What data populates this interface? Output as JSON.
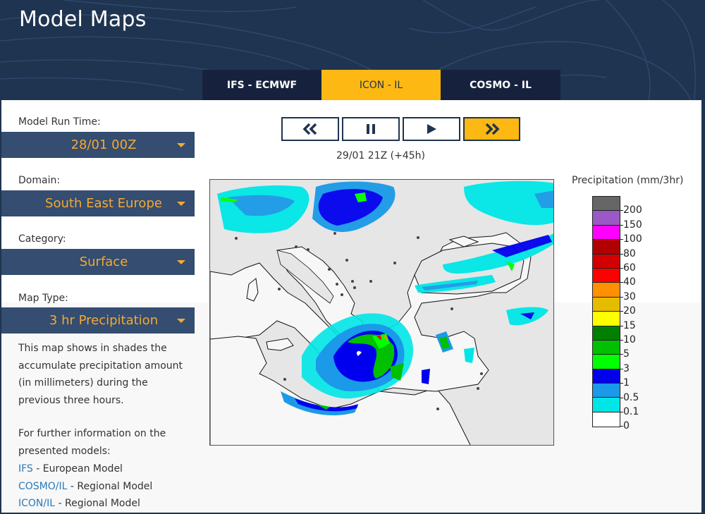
{
  "header": {
    "title": "Model Maps"
  },
  "tabs": [
    {
      "label": "IFS - ECMWF",
      "active": false
    },
    {
      "label": "ICON - IL",
      "active": true
    },
    {
      "label": "COSMO - IL",
      "active": false
    }
  ],
  "sidebar": {
    "model_run_time": {
      "label": "Model Run Time:",
      "value": "28/01 00Z"
    },
    "domain": {
      "label": "Domain:",
      "value": "South East Europe"
    },
    "category": {
      "label": "Category:",
      "value": "Surface"
    },
    "map_type": {
      "label": "Map Type:",
      "value": "3 hr Precipitation"
    },
    "description": "This map shows in shades the accumulate precipitation amount (in millimeters) during the previous three hours.",
    "further_info": "For further information on the presented models:",
    "links": [
      {
        "link": "IFS",
        "text": " - European Model"
      },
      {
        "link": "COSMO/IL",
        "text": " - Regional Model"
      },
      {
        "link": "ICON/IL",
        "text": " - Regional Model"
      }
    ]
  },
  "controls": {
    "rewind_icon": "double-chevron-left",
    "pause_icon": "pause",
    "play_icon": "play",
    "forward_icon": "double-chevron-right"
  },
  "timestamp": "29/01 21Z (+45h)",
  "legend": {
    "title": "Precipitation (mm/3hr)",
    "colors": [
      "#666666",
      "#9b59c6",
      "#ff00ff",
      "#b00000",
      "#d40000",
      "#ff0000",
      "#ff9000",
      "#e6bc00",
      "#ffff00",
      "#008000",
      "#00c000",
      "#00ff00",
      "#0000ee",
      "#1a9ae8",
      "#00e6e6",
      "#ffffff"
    ],
    "ticks": [
      "200",
      "150",
      "100",
      "80",
      "60",
      "40",
      "30",
      "20",
      "15",
      "10",
      "5",
      "3",
      "1",
      "0.5",
      "0.1",
      "0"
    ]
  },
  "colors": {
    "header_bg": "#1f3450",
    "tab_bg": "#16223d",
    "accent": "#fdb813",
    "select_bg": "#344d70",
    "select_text": "#f4a933",
    "link": "#2a7ab8"
  }
}
